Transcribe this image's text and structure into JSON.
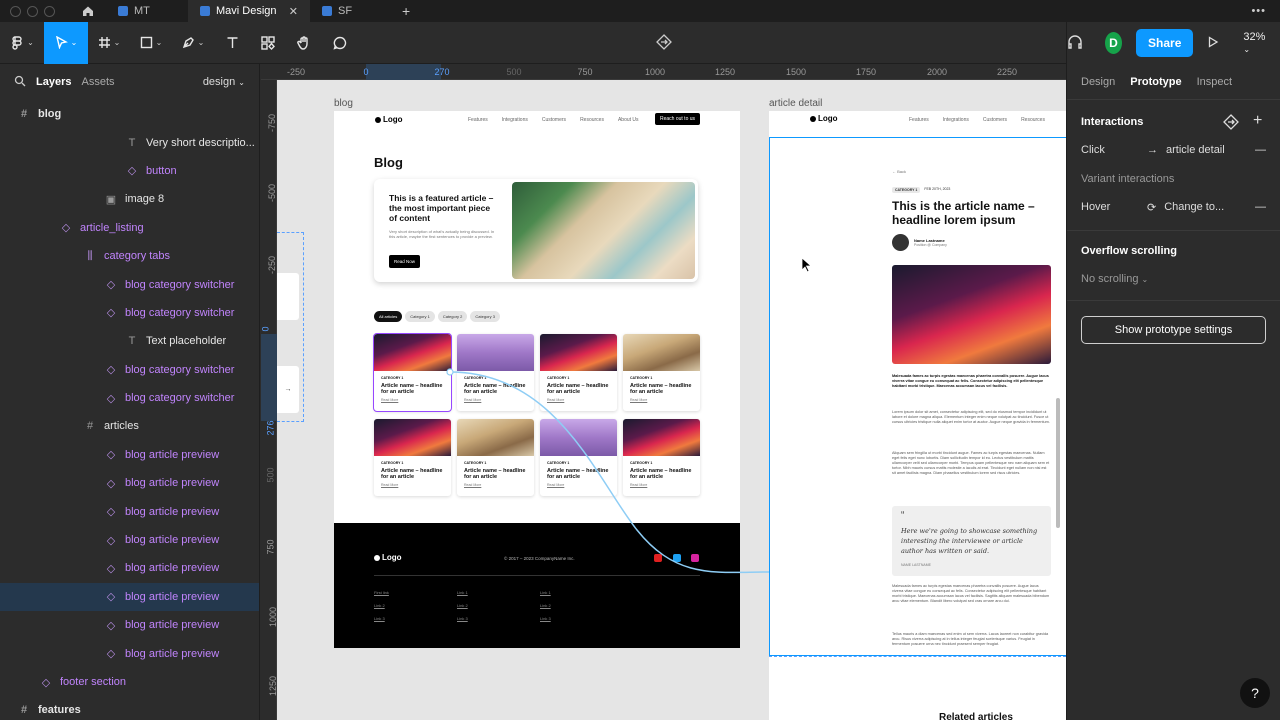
{
  "tabs": [
    {
      "label": "MT"
    },
    {
      "label": "Mavi Design",
      "active": true
    },
    {
      "label": "SF"
    }
  ],
  "toolbar": {
    "share_label": "Share",
    "zoom": "32%",
    "avatar_initial": "D",
    "accent": "#0d99ff"
  },
  "left_panel": {
    "tab_layers": "Layers",
    "tab_assets": "Assets",
    "page": "design",
    "layers": [
      {
        "label": "blog",
        "icon": "#"
      },
      {
        "label": "Very short descriptio...",
        "icon": "T"
      },
      {
        "label": "button",
        "icon": "◇"
      },
      {
        "label": "image 8",
        "icon": "▣"
      },
      {
        "label": "article_listing",
        "icon": "◇"
      },
      {
        "label": "category tabs",
        "icon": "⫼"
      },
      {
        "label": "blog category switcher",
        "icon": "◇"
      },
      {
        "label": "blog category switcher",
        "icon": "◇"
      },
      {
        "label": "Text placeholder",
        "icon": "T"
      },
      {
        "label": "blog category switcher",
        "icon": "◇"
      },
      {
        "label": "blog category switcher",
        "icon": "◇"
      },
      {
        "label": "articles",
        "icon": "#"
      },
      {
        "label": "blog article preview",
        "icon": "◇"
      },
      {
        "label": "blog article preview",
        "icon": "◇"
      },
      {
        "label": "blog article preview",
        "icon": "◇"
      },
      {
        "label": "blog article preview",
        "icon": "◇"
      },
      {
        "label": "blog article preview",
        "icon": "◇"
      },
      {
        "label": "blog article preview",
        "icon": "◇"
      },
      {
        "label": "blog article preview",
        "icon": "◇"
      },
      {
        "label": "blog article preview",
        "icon": "◇"
      },
      {
        "label": "footer section",
        "icon": "◇"
      },
      {
        "label": "features",
        "icon": "#"
      }
    ]
  },
  "ruler_top": [
    "-250",
    "0",
    "270",
    "500",
    "750",
    "1000",
    "1250",
    "1500",
    "1750",
    "2000",
    "2250"
  ],
  "ruler_left": [
    "-750",
    "-500",
    "-250",
    "0",
    "276",
    "500",
    "750",
    "1000",
    "1250"
  ],
  "canvas": {
    "frame_blog_label": "blog",
    "frame_article_label": "article detail",
    "logo": "Logo",
    "nav_items": [
      "Features",
      "Integrations",
      "Customers",
      "Resources",
      "About Us"
    ],
    "nav_cta": "Reach out to us",
    "blog_title": "Blog",
    "featured_title": "This is a featured article – the most important piece of content",
    "featured_desc": "Very short description of what's actually being discussed. In this article, maybe the first sentences to provide a preview.",
    "read_now": "Read Now",
    "chips": [
      "All articles",
      "Category 1",
      "Category 2",
      "Category 3"
    ],
    "card_category": "CATEGORY 1",
    "card_title": "Article name – headline for an article",
    "card_read_more": "Read More",
    "copyright": "© 2017 – 2023 CompanyName Inc.",
    "footer_links": [
      "First link",
      "Link 1",
      "Link 1",
      "Link 2",
      "Link 2",
      "Link 2",
      "Link 3",
      "Link 3",
      "Link 3"
    ],
    "back": "← Back",
    "article_category": "CATEGORY 1",
    "article_date": "FEB 20TH, 2023",
    "article_title": "This is the article name – headline lorem ipsum",
    "author_name": "Name Lastname",
    "author_position": "Position @ Company",
    "lead": "Malesuada fames ac turpis egestas maecenas pharetra convallis posuere. Augue lacus viverra vitae congue eu consequat ac felis. Consectetur adipiscing elit pellentesque habitant morbi tristique. Maecenas accumsan lacus vel facilisis.",
    "para1": "Lorem ipsum dolor sit amet, consectetur adipiscing elit, sed do eiusmod tempor incididunt ut labore et dolore magna aliqua. Elementum integer enim neque volutpat ac tincidunt. Fusce ut cursus ultricies tristique nulla aliquet enim tortor at auctor. Augue neque gravida in fermentum.",
    "para2": "Aliquam sem fringilla ut morbi tincidunt augue. Fames ac turpis egestas maecenas. Nullam eget felis eget nunc lobortis. Diam sollicitudin tempor id eu. Lectus vestibulum mattis ullamcorper velit sed ullamcorper morbi. Tempus quam pellentesque nec nam aliquam sem et tortor. Nibh mauris cursus mattis molestie a iaculis at erat. Tincidunt eget nullam non nisi est sit amet facilisis magna. Diam phasellus vestibulum lorem sed risus ultricies.",
    "quote_mark": "“",
    "quote": "Here we're going to showcase something interesting the interviewee or article author has written or said.",
    "quote_author": "NAME LASTNAME",
    "para3": "Malesuada fames ac turpis egestas maecenas pharetra convallis posuere. Augue lacus viverra vitae congue eu consequat ac felis. Consectetur adipiscing elit pellentesque habitant morbi tristique. Maecenas accumsan lacus vel facilisis. Sagittis aliquam malesuada bibendum arcu vitae elementum. Blandit libero volutpat sed cras ornare arcu dui.",
    "para4": "Tellus mauris a diam maecenas sed enim ut sem viverra. Lacus laoreet non curabitur gravida arcu. Risus viverra adipiscing at in tellus integer feugiat scelerisque varius. Feugiat in fermentum posuere urna nec tincidunt praesent semper feugiat.",
    "related": "Related articles"
  },
  "right_panel": {
    "tabs": [
      "Design",
      "Prototype",
      "Inspect"
    ],
    "interactions_title": "Interactions",
    "click_label": "Click",
    "click_target": "article detail",
    "variant_interactions": "Variant interactions",
    "hover_label": "Hover",
    "hover_target": "Change to...",
    "overflow_title": "Overflow scrolling",
    "overflow_value": "No scrolling",
    "proto_settings": "Show prototype settings",
    "help": "?"
  }
}
